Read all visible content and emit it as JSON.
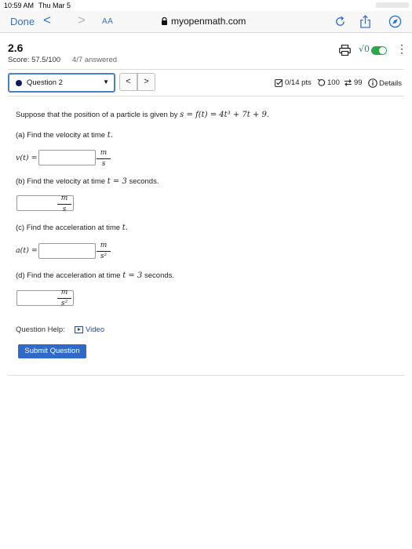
{
  "status_bar": {
    "time": "10:59 AM",
    "date": "Thu Mar 5"
  },
  "browser": {
    "done_label": "Done",
    "back_glyph": "<",
    "forward_glyph": ">",
    "text_size_label": "AA",
    "url": "myopenmath.com",
    "icons": [
      "lock-icon",
      "reload-icon",
      "share-icon",
      "compass-icon"
    ]
  },
  "header": {
    "title": "2.6",
    "score": "Score: 57.5/100",
    "answered": "4/7 answered",
    "math_icon_text": "√0",
    "icons": [
      "print-icon",
      "math-entry-icon",
      "toggle-switch",
      "more-options-icon"
    ]
  },
  "question_nav": {
    "selected": "Question 2",
    "prev_glyph": "<",
    "next_glyph": ">",
    "points": "0/14 pts",
    "attempts": "100",
    "versions": "99",
    "details": "Details",
    "accent": "#4a7fd0"
  },
  "question": {
    "intro_text": "Suppose that the position of a particle is given by ",
    "intro_math": "s = f(t) = 4t³ + 7t + 9.",
    "part_a": {
      "text": "(a) Find the velocity at time ",
      "math": "t.",
      "label": "v(t) =",
      "value": "",
      "unit_num": "m",
      "unit_den": "s"
    },
    "part_b": {
      "text": "(b) Find the velocity at time ",
      "math": "t = 3",
      "text_after": " seconds.",
      "value": "",
      "unit_num": "m",
      "unit_den": "s"
    },
    "part_c": {
      "text": "(c) Find the acceleration at time ",
      "math": "t.",
      "label": "a(t) =",
      "value": "",
      "unit_num": "m",
      "unit_den": "s²"
    },
    "part_d": {
      "text": "(d) Find the acceleration at time ",
      "math": "t = 3",
      "text_after": " seconds.",
      "value": "",
      "unit_num": "m",
      "unit_den": "s²"
    }
  },
  "help": {
    "label": "Question Help:",
    "video": "Video"
  },
  "submit_label": "Submit Question"
}
